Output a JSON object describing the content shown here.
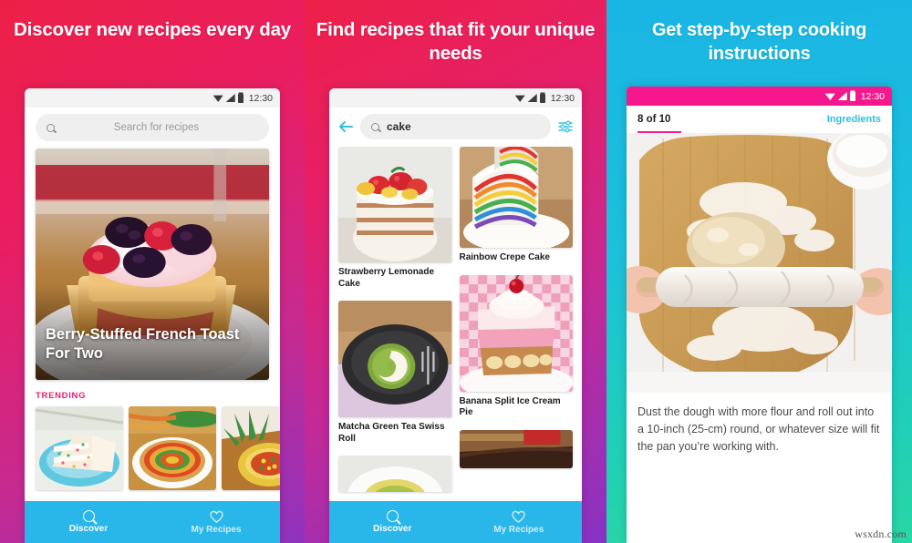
{
  "panels": [
    {
      "headline": "Discover new recipes every day",
      "statusbar": {
        "time": "12:30",
        "icons": [
          "wifi-icon",
          "signal-icon",
          "battery-icon"
        ]
      },
      "search": {
        "placeholder": "Search for recipes",
        "icon": "search-icon"
      },
      "hero": {
        "title": "Berry-Stuffed French Toast For Two"
      },
      "section_label": "TRENDING",
      "thumbnails": [
        "funfetti-layer-cake",
        "rainbow-vegetable-tart",
        "pineapple-boat-salsa"
      ],
      "bottom_nav": [
        {
          "label": "Discover",
          "icon": "search-icon",
          "active": true
        },
        {
          "label": "My Recipes",
          "icon": "heart-icon",
          "active": false
        }
      ]
    },
    {
      "headline": "Find recipes that fit your unique needs",
      "statusbar": {
        "time": "12:30",
        "icons": [
          "wifi-icon",
          "signal-icon",
          "battery-icon"
        ]
      },
      "search": {
        "value": "cake",
        "icon": "search-icon",
        "back_icon": "back-arrow-icon",
        "filter_icon": "tune-icon"
      },
      "results": [
        {
          "title": "Strawberry Lemonade Cake",
          "column": 0
        },
        {
          "title": "Rainbow Crepe Cake",
          "column": 1
        },
        {
          "title": "Matcha Green Tea Swiss Roll",
          "column": 0
        },
        {
          "title": "Banana Split Ice Cream Pie",
          "column": 1
        }
      ],
      "bottom_nav": [
        {
          "label": "Discover",
          "icon": "search-icon",
          "active": true
        },
        {
          "label": "My Recipes",
          "icon": "heart-icon",
          "active": false
        }
      ]
    },
    {
      "headline": "Get step-by-step cooking instructions",
      "statusbar": {
        "time": "12:30",
        "icons": [
          "wifi-icon",
          "signal-icon",
          "battery-icon"
        ]
      },
      "tabs": {
        "step_counter": "8 of 10",
        "ingredients_label": "Ingredients"
      },
      "instruction": "Dust the dough with more flour and roll out into a 10-inch (25-cm) round, or whatever size will fit the pan you’re working with."
    }
  ],
  "watermark": "wsxdn.com",
  "colors": {
    "panel1_start": "#ec2046",
    "panel1_end": "#8e33c0",
    "panel3_start": "#19b5e4",
    "panel3_end": "#2ad6a4",
    "nav_bar": "#29b6e8",
    "trending_label": "#e51f6e",
    "status_bar_pink": "#f4188c",
    "ingredients_cyan": "#29c0dd",
    "tab_underline": "#ef1f8e"
  }
}
